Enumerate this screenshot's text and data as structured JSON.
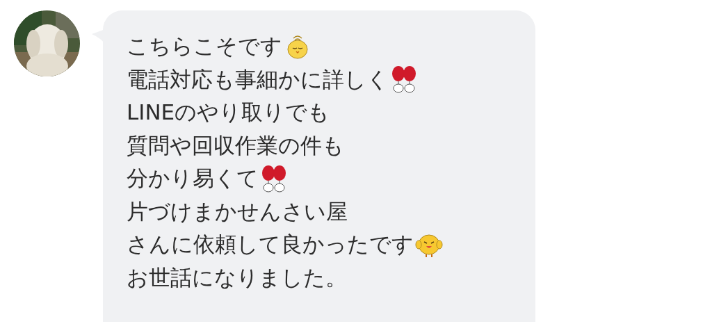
{
  "message": {
    "lines": [
      {
        "text": "こちらこそです",
        "kind": "sleepy"
      },
      {
        "text": "電話対応も事細かに詳しく",
        "kind": "balloons"
      },
      {
        "text": "LINEのやり取りでも",
        "kind": "text"
      },
      {
        "text": "質問や回収作業の件も",
        "kind": "text"
      },
      {
        "text": "分かり易くて",
        "kind": "balloons"
      },
      {
        "text": "片づけまかせんさい屋",
        "kind": "text"
      },
      {
        "text": "さんに依頼して良かったです",
        "kind": "cheer"
      },
      {
        "text": "お世話になりました。",
        "kind": "text"
      }
    ]
  }
}
